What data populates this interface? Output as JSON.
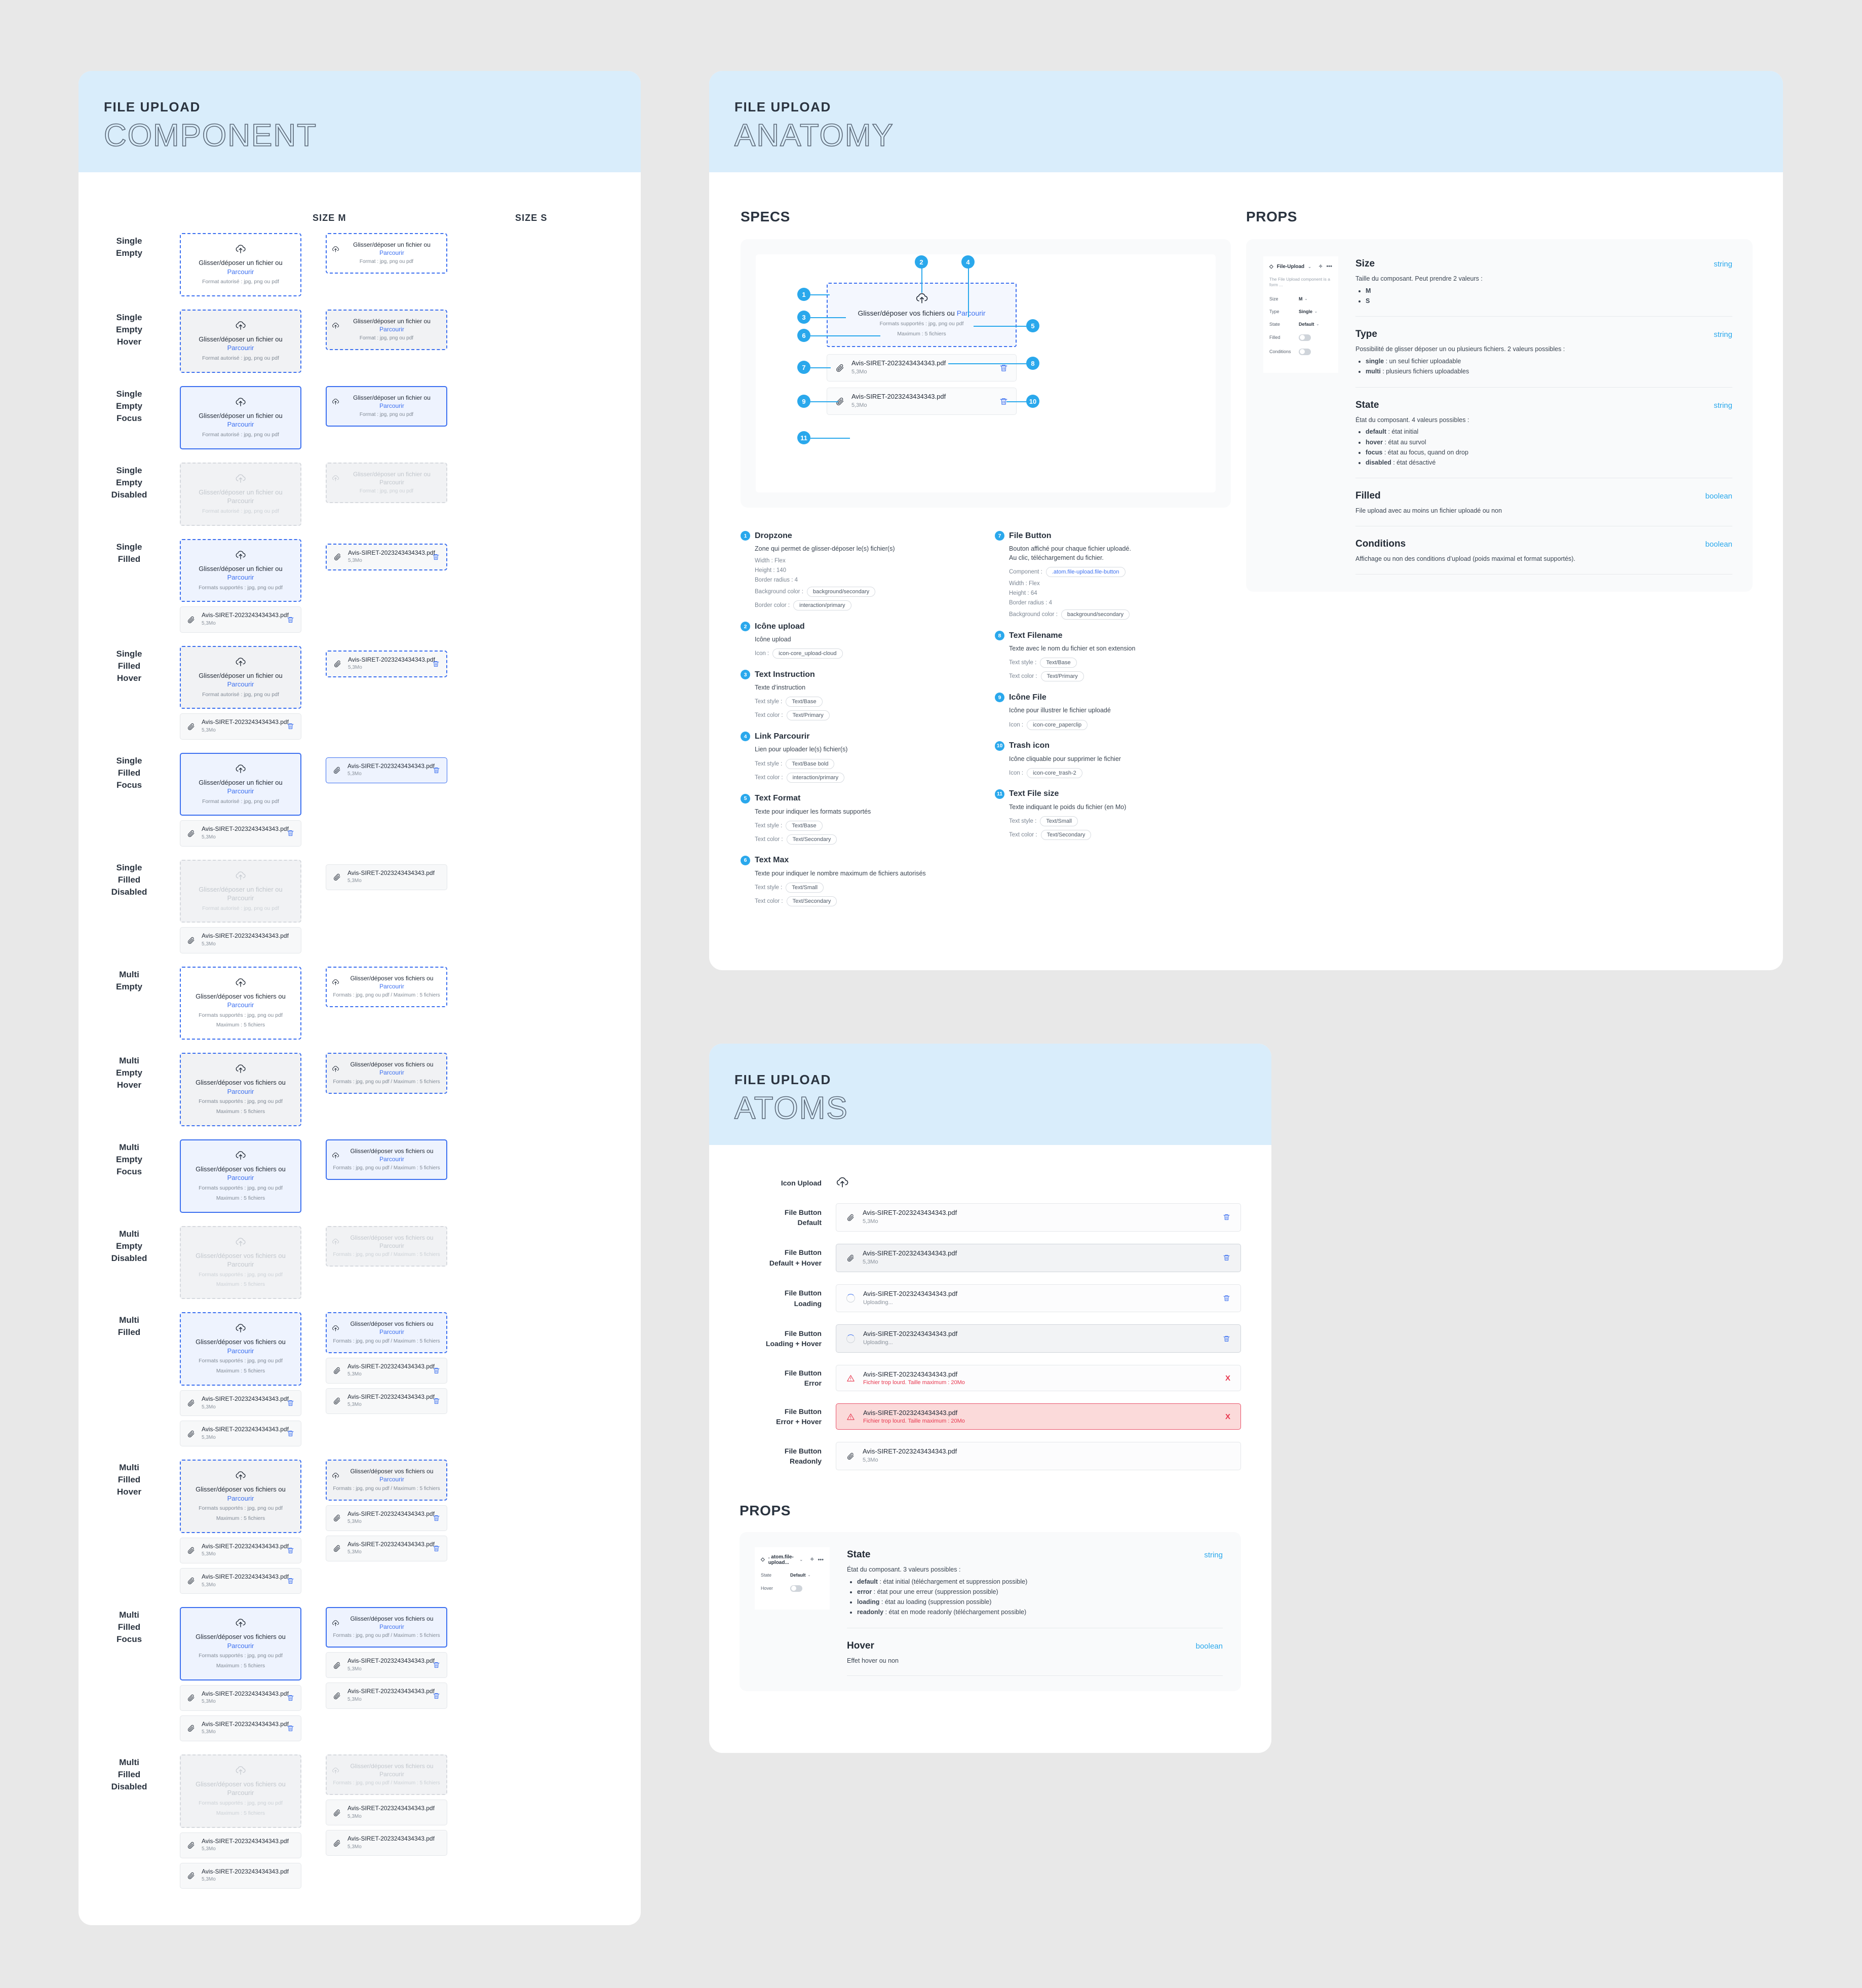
{
  "colors": {
    "accent_blue": "#3b6ff0",
    "badge_blue": "#2aa8ec",
    "header_bg": "#d9edfb",
    "error_red": "#e8384f",
    "text_primary": "#242c38",
    "text_secondary": "#828b96"
  },
  "component_card": {
    "eyebrow": "FILE UPLOAD",
    "title": "COMPONENT",
    "columns": [
      {
        "label": "SIZE M"
      },
      {
        "label": "SIZE S"
      }
    ],
    "strings": {
      "instruction_single": "Glisser/déposer un fichier ou ",
      "instruction_multi": "Glisser/déposer vos fichiers ou ",
      "browse_link": "Parcourir",
      "format_m_single": "Format autorisé : jpg, png ou pdf",
      "format_m_multi": "Formats supportés : jpg, png ou pdf",
      "max_m": "Maximum : 5 fichiers",
      "format_s_single": "Format : jpg, png ou pdf",
      "format_s_multi": "Formats : jpg, png ou pdf / Maximum : 5 fichiers",
      "filename": "Avis-SIRET-2023243434343.pdf",
      "filesize": "5,3Mo"
    },
    "rows": [
      {
        "label": "Single\nEmpty"
      },
      {
        "label": "Single\nEmpty\nHover"
      },
      {
        "label": "Single\nEmpty\nFocus"
      },
      {
        "label": "Single\nEmpty\nDisabled"
      },
      {
        "label": "Single\nFilled"
      },
      {
        "label": "Single\nFilled\nHover"
      },
      {
        "label": "Single\nFilled\nFocus"
      },
      {
        "label": "Single\nFilled\nDisabled"
      },
      {
        "label": "Multi\nEmpty"
      },
      {
        "label": "Multi\nEmpty\nHover"
      },
      {
        "label": "Multi\nEmpty\nFocus"
      },
      {
        "label": "Multi\nEmpty\nDisabled"
      },
      {
        "label": "Multi\nFilled"
      },
      {
        "label": "Multi\nFilled\nHover"
      },
      {
        "label": "Multi\nFilled\nFocus"
      },
      {
        "label": "Multi\nFilled\nDisabled"
      }
    ]
  },
  "anatomy_card": {
    "eyebrow": "FILE UPLOAD",
    "title": "ANATOMY",
    "specs_label": "SPECS",
    "props_label": "PROPS",
    "diagram": {
      "instruction": "Glisser/déposer vos fichiers ou ",
      "browse_link": "Parcourir",
      "formats": "Formats supportés : jpg, png ou pdf",
      "maximum": "Maximum : 5 fichiers",
      "filename": "Avis-SIRET-2023243434343.pdf",
      "filesize": "5,3Mo",
      "badges": [
        "1",
        "2",
        "3",
        "4",
        "5",
        "6",
        "7",
        "8",
        "9",
        "10",
        "11"
      ]
    },
    "legend_left": [
      {
        "num": "1",
        "title": "Dropzone",
        "desc": "Zone qui permet de glisser-déposer le(s) fichier(s)",
        "attrs": [
          {
            "key": "Width : Flex",
            "pill": null
          },
          {
            "key": "Height : 140",
            "pill": null
          },
          {
            "key": "Border radius : 4",
            "pill": null
          },
          {
            "key": "Background color :",
            "pill": "background/secondary"
          },
          {
            "key": "Border color :",
            "pill": "interaction/primary"
          }
        ]
      },
      {
        "num": "2",
        "title": "Icône upload",
        "desc": "Icône upload",
        "attrs": [
          {
            "key": "Icon :",
            "pill": "icon-core_upload-cloud"
          }
        ]
      },
      {
        "num": "3",
        "title": "Text Instruction",
        "desc": "Texte d’instruction",
        "attrs": [
          {
            "key": "Text style :",
            "pill": "Text/Base"
          },
          {
            "key": "Text color :",
            "pill": "Text/Primary"
          }
        ]
      },
      {
        "num": "4",
        "title": "Link Parcourir",
        "desc": "Lien pour uploader le(s) fichier(s)",
        "attrs": [
          {
            "key": "Text style :",
            "pill": "Text/Base bold"
          },
          {
            "key": "Text color :",
            "pill": "interaction/primary"
          }
        ]
      },
      {
        "num": "5",
        "title": "Text Format",
        "desc": "Texte pour indiquer les formats supportés",
        "attrs": [
          {
            "key": "Text style :",
            "pill": "Text/Base"
          },
          {
            "key": "Text color :",
            "pill": "Text/Secondary"
          }
        ]
      },
      {
        "num": "6",
        "title": "Text Max",
        "desc": "Texte pour indiquer le nombre maximum de fichiers autorisés",
        "attrs": [
          {
            "key": "Text style :",
            "pill": "Text/Small"
          },
          {
            "key": "Text color :",
            "pill": "Text/Secondary"
          }
        ]
      }
    ],
    "legend_right": [
      {
        "num": "7",
        "title": "File Button",
        "desc": "Bouton affiché pour chaque fichier uploadé.\nAu clic, téléchargement du fichier.",
        "attrs": [
          {
            "key": "Component :",
            "pill": ".atom.file-upload.file-button",
            "blue": true
          },
          {
            "key": "Width : Flex",
            "pill": null
          },
          {
            "key": "Height : 64",
            "pill": null
          },
          {
            "key": "Border radius : 4",
            "pill": null
          },
          {
            "key": "Background color :",
            "pill": "background/secondary"
          }
        ]
      },
      {
        "num": "8",
        "title": "Text Filename",
        "desc": "Texte avec le nom du fichier et son extension",
        "attrs": [
          {
            "key": "Text style :",
            "pill": "Text/Base"
          },
          {
            "key": "Text color :",
            "pill": "Text/Primary"
          }
        ]
      },
      {
        "num": "9",
        "title": "Icône File",
        "desc": "Icône pour illustrer le fichier uploadé",
        "attrs": [
          {
            "key": "Icon :",
            "pill": "icon-core_paperclip"
          }
        ]
      },
      {
        "num": "10",
        "title": "Trash icon",
        "desc": "Icône cliquable pour supprimer le fichier",
        "attrs": [
          {
            "key": "Icon :",
            "pill": "icon-core_trash-2"
          }
        ]
      },
      {
        "num": "11",
        "title": "Text File size",
        "desc": "Texte indiquant le poids du fichier (en Mo)",
        "attrs": [
          {
            "key": "Text style :",
            "pill": "Text/Small"
          },
          {
            "key": "Text color :",
            "pill": "Text/Secondary"
          }
        ]
      }
    ],
    "figma_panel": {
      "component_name": "File-Upload",
      "description": "The File Upload component is a form ...",
      "rows": [
        {
          "key": "Size",
          "value": "M",
          "type": "select"
        },
        {
          "key": "Type",
          "value": "Single",
          "type": "select"
        },
        {
          "key": "State",
          "value": "Default",
          "type": "select"
        },
        {
          "key": "Filled",
          "value": "",
          "type": "toggle"
        },
        {
          "key": "Conditions",
          "value": "",
          "type": "toggle"
        }
      ]
    },
    "props": [
      {
        "name": "Size",
        "type": "string",
        "desc": "Taille du composant. Peut prendre 2 valeurs :",
        "items": [
          {
            "b": "M",
            "t": ""
          },
          {
            "b": "S",
            "t": ""
          }
        ]
      },
      {
        "name": "Type",
        "type": "string",
        "desc": "Possibilité de glisser déposer un ou plusieurs fichiers. 2 valeurs possibles :",
        "items": [
          {
            "b": "single",
            "t": " : un seul fichier uploadable"
          },
          {
            "b": "multi",
            "t": " : plusieurs fichiers uploadables"
          }
        ]
      },
      {
        "name": "State",
        "type": "string",
        "desc": "État du composant. 4 valeurs possibles :",
        "items": [
          {
            "b": "default",
            "t": " : état initial"
          },
          {
            "b": "hover",
            "t": " : état au survol"
          },
          {
            "b": "focus",
            "t": " : état au focus, quand on drop"
          },
          {
            "b": "disabled",
            "t": " : état désactivé"
          }
        ]
      },
      {
        "name": "Filled",
        "type": "boolean",
        "desc": "File upload avec au moins un fichier uploadé ou non",
        "items": []
      },
      {
        "name": "Conditions",
        "type": "boolean",
        "desc": "Affichage ou non des conditions d’upload (poids maximal et format supportés).",
        "items": []
      }
    ]
  },
  "atoms_card": {
    "eyebrow": "FILE UPLOAD",
    "title": "ATOMS",
    "props_label": "PROPS",
    "icon_upload_label": "Icon Upload",
    "strings": {
      "filename": "Avis-SIRET-2023243434343.pdf",
      "filesize": "5,3Mo",
      "uploading": "Uploading...",
      "error_msg": "Fichier trop lourd. Taille maximum : 20Mo",
      "close": "X"
    },
    "rows": [
      {
        "label": "File Button\nDefault",
        "state": "default"
      },
      {
        "label": "File Button\nDefault + Hover",
        "state": "default-hover"
      },
      {
        "label": "File Button\nLoading",
        "state": "loading"
      },
      {
        "label": "File Button\nLoading + Hover",
        "state": "loading-hover"
      },
      {
        "label": "File Button\nError",
        "state": "error"
      },
      {
        "label": "File Button\nError + Hover",
        "state": "error-hover"
      },
      {
        "label": "File Button\nReadonly",
        "state": "readonly"
      }
    ],
    "figma_panel": {
      "component_name": ". atom.file-upload...",
      "rows": [
        {
          "key": "State",
          "value": "Default",
          "type": "select"
        },
        {
          "key": "Hover",
          "value": "",
          "type": "toggle"
        }
      ]
    },
    "props": [
      {
        "name": "State",
        "type": "string",
        "desc": "État du composant. 3 valeurs possibles :",
        "items": [
          {
            "b": "default",
            "t": " : état initial (téléchargement et suppression possible)"
          },
          {
            "b": "error",
            "t": " : état pour une erreur (suppression possible)"
          },
          {
            "b": "loading",
            "t": " : état au loading (suppression possible)"
          },
          {
            "b": "readonly",
            "t": " : état en mode readonly (téléchargement possible)"
          }
        ]
      },
      {
        "name": "Hover",
        "type": "boolean",
        "desc": "Effet hover ou non",
        "items": []
      }
    ]
  }
}
